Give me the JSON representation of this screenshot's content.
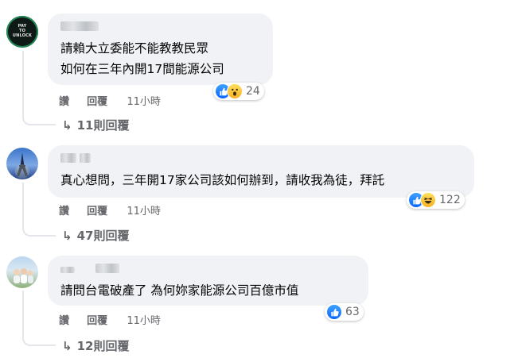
{
  "comments": [
    {
      "text_lines": [
        "請賴大立委能不能教教民眾",
        "如何在三年內開17間能源公司"
      ],
      "actions": {
        "like": "讚",
        "reply": "回覆",
        "time": "11小時"
      },
      "reactions": {
        "icons": [
          "like-icon",
          "wow-icon"
        ],
        "count": "24"
      },
      "replies": "11則回覆",
      "avatar": {
        "text": [
          "PAY",
          "TO",
          "UNLOCK"
        ],
        "icon": "pay-to-unlock-avatar"
      }
    },
    {
      "text_lines": [
        "真心想問，三年開17家公司該如何辦到，請收我為徒，拜託"
      ],
      "actions": {
        "like": "讚",
        "reply": "回覆",
        "time": "11小時"
      },
      "reactions": {
        "icons": [
          "like-icon",
          "haha-icon"
        ],
        "count": "122"
      },
      "replies": "47則回覆",
      "avatar": {
        "icon": "eiffel-tower-avatar"
      }
    },
    {
      "text_lines": [
        "請問台電破產了 為何妳家能源公司百億市值"
      ],
      "actions": {
        "like": "讚",
        "reply": "回覆",
        "time": "11小時"
      },
      "reactions": {
        "icons": [
          "like-icon"
        ],
        "count": "63"
      },
      "replies": "12則回覆",
      "avatar": {
        "icon": "group-photo-avatar"
      }
    }
  ],
  "colors": {
    "bubble": "#f0f2f5",
    "meta": "#65676b",
    "text": "#050505",
    "like_blue": "#0866ff"
  },
  "reply_arrow_icon": "reply-arrow-icon"
}
